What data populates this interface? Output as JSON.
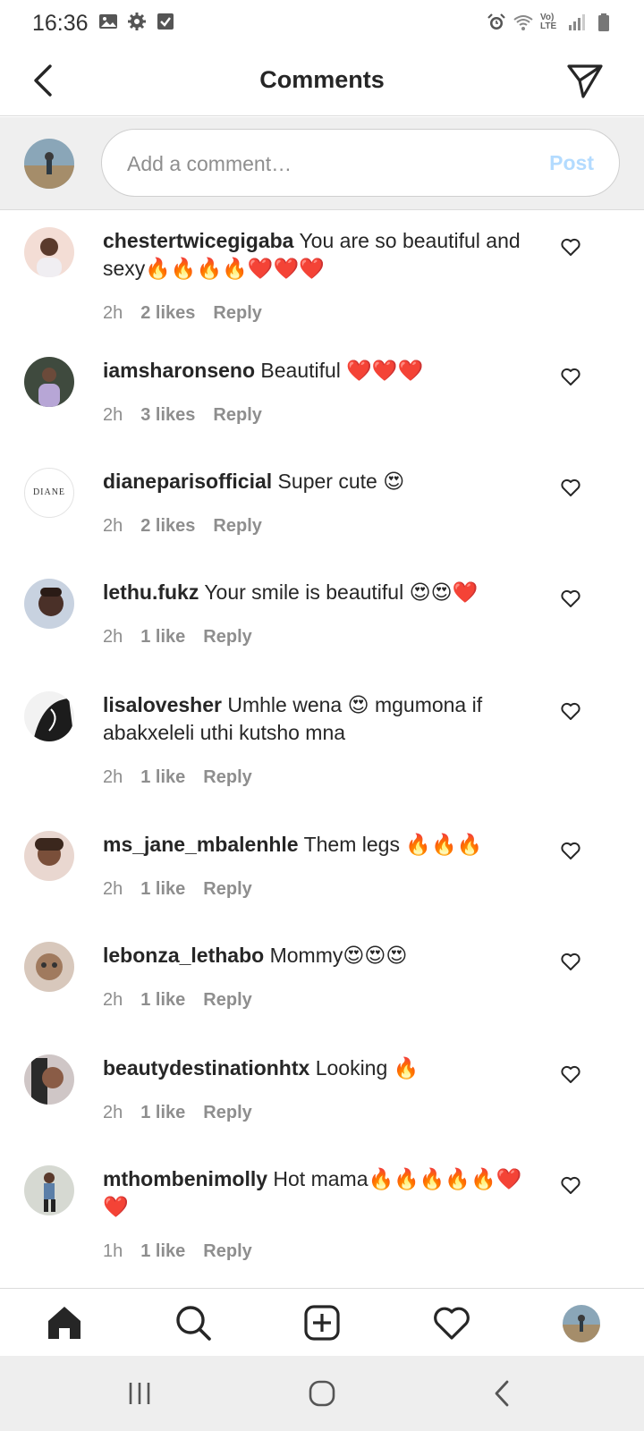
{
  "status_bar": {
    "time": "16:36",
    "left_icons": [
      "image-icon",
      "settings-icon",
      "checkbox-icon"
    ],
    "right_icons": [
      "alarm-icon",
      "wifi-icon",
      "volte-icon",
      "signal-icon",
      "battery-icon"
    ],
    "volte_text": "Vo) LTE"
  },
  "header": {
    "title": "Comments"
  },
  "compose": {
    "placeholder": "Add a comment…",
    "post_label": "Post"
  },
  "comments": [
    {
      "username": "chestertwicegigaba",
      "text": " You are so beautiful and sexy🔥🔥🔥🔥❤️❤️❤️",
      "time": "2h",
      "likes": "2 likes",
      "reply": "Reply"
    },
    {
      "username": "iamsharonseno",
      "text": " Beautiful ❤️❤️❤️",
      "time": "2h",
      "likes": "3 likes",
      "reply": "Reply"
    },
    {
      "username": "dianeparisofficial",
      "text": " Super cute 😍",
      "time": "2h",
      "likes": "2 likes",
      "reply": "Reply",
      "avatar_text": "DIANE"
    },
    {
      "username": "lethu.fukz",
      "text": " Your smile is beautiful 😍😍❤️",
      "time": "2h",
      "likes": "1 like",
      "reply": "Reply"
    },
    {
      "username": "lisalovesher",
      "text": " Umhle wena 😍 mgumona if abakxeleli uthi kutsho mna",
      "time": "2h",
      "likes": "1 like",
      "reply": "Reply"
    },
    {
      "username": "ms_jane_mbalenhle",
      "text": " Them legs 🔥🔥🔥",
      "time": "2h",
      "likes": "1 like",
      "reply": "Reply"
    },
    {
      "username": "lebonza_lethabo",
      "text": " Mommy😍😍😍",
      "time": "2h",
      "likes": "1 like",
      "reply": "Reply"
    },
    {
      "username": "beautydestinationhtx",
      "text": " Looking 🔥",
      "time": "2h",
      "likes": "1 like",
      "reply": "Reply"
    },
    {
      "username": "mthombenimolly",
      "text": " Hot mama🔥🔥🔥🔥🔥❤️❤️",
      "time": "1h",
      "likes": "1 like",
      "reply": "Reply"
    }
  ],
  "bottom_nav": [
    "home-icon",
    "search-icon",
    "new-post-icon",
    "activity-icon",
    "profile-avatar"
  ],
  "system_nav": [
    "recents-icon",
    "home-circle-icon",
    "back-icon"
  ],
  "colors": {
    "text": "#262626",
    "secondary": "#8e8e8e",
    "post_disabled": "#b3dbff",
    "divider": "#dbdbdb",
    "compose_bg": "#efefef"
  }
}
